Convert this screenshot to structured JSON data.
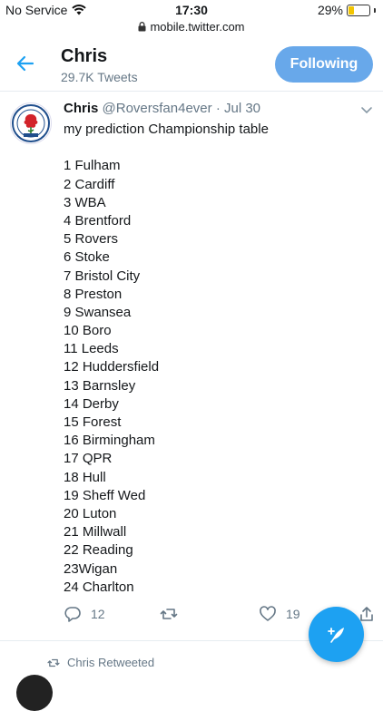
{
  "status_bar": {
    "carrier": "No Service",
    "time": "17:30",
    "battery": "29%",
    "battery_level": 0.29,
    "url": "mobile.twitter.com"
  },
  "header": {
    "name": "Chris",
    "tweet_count": "29.7K Tweets",
    "follow_label": "Following"
  },
  "tweet": {
    "name": "Chris",
    "handle": "@Roversfan4ever",
    "date": "Jul 30",
    "text": "my prediction Championship table",
    "table": [
      "1 Fulham",
      "2 Cardiff",
      "3 WBA",
      "4 Brentford",
      "5 Rovers",
      "6 Stoke",
      "7 Bristol City",
      "8 Preston",
      "9 Swansea",
      "10 Boro",
      "11 Leeds",
      "12 Huddersfield",
      "13 Barnsley",
      "14 Derby",
      "15 Forest",
      "16 Birmingham",
      "17 QPR",
      "18 Hull",
      "19 Sheff Wed",
      "20 Luton",
      "21 Millwall",
      "22 Reading",
      "23Wigan",
      "24 Charlton"
    ],
    "replies": "12",
    "likes": "19"
  },
  "retweet_notice": "Chris Retweeted",
  "colors": {
    "accent": "#1da1f2",
    "following_button": "#68a8ea",
    "muted_text": "#657786"
  }
}
